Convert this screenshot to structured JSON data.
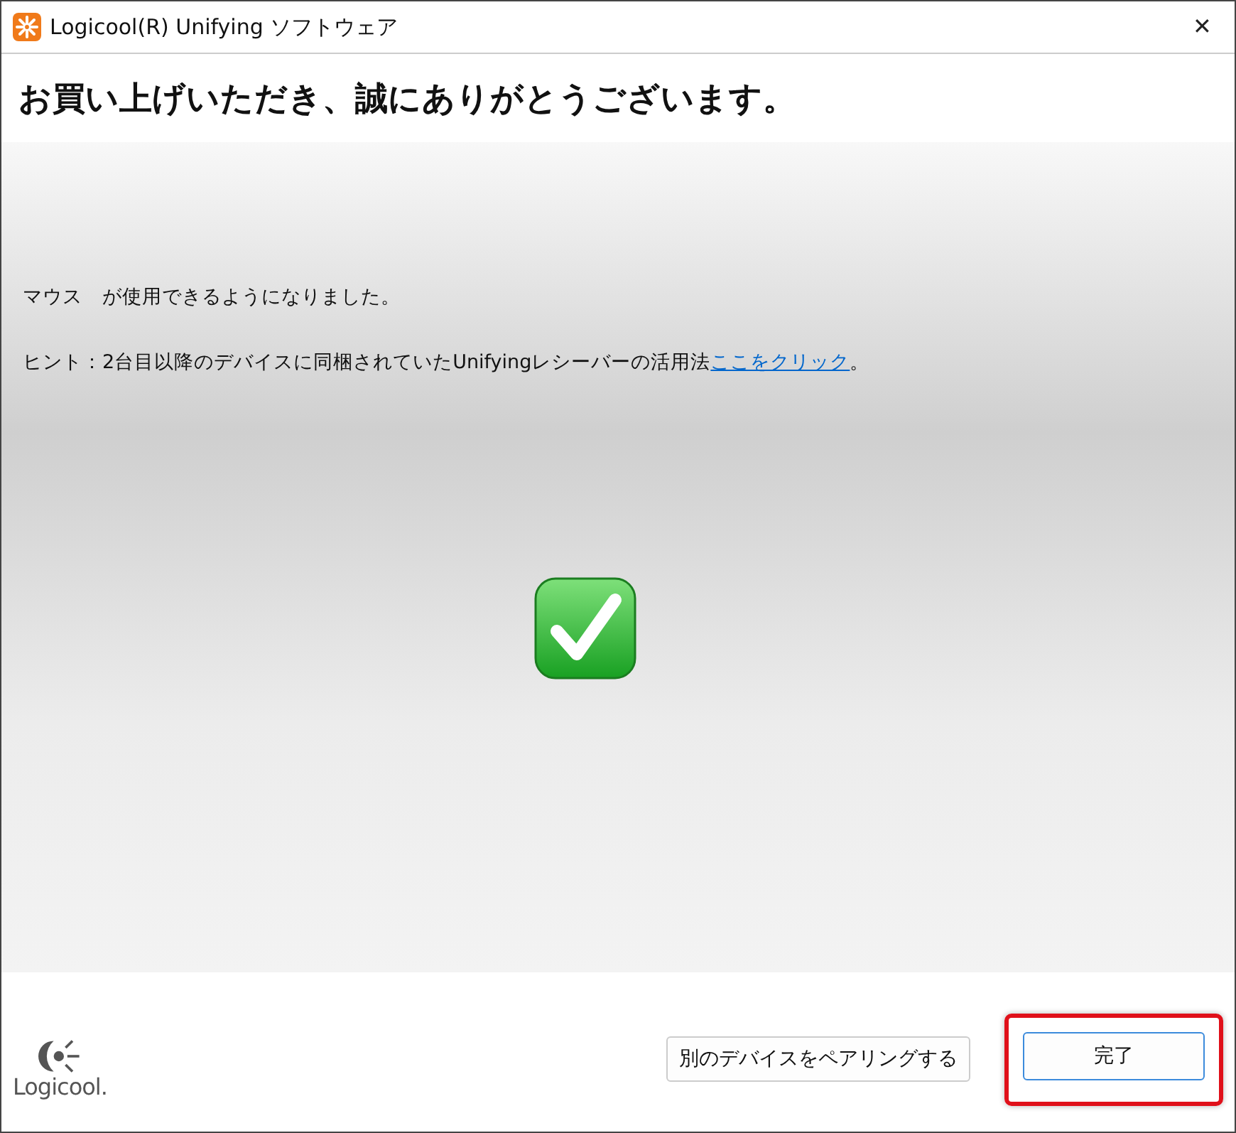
{
  "window": {
    "title": "Logicool(R) Unifying ソフトウェア",
    "close": "✕"
  },
  "heading": "お買い上げいただき、誠にありがとうございます。",
  "message": "マウス　が使用できるようになりました。",
  "hint": {
    "text": "ヒント：2台目以降のデバイスに同梱されていたUnifyingレシーバーの活用法",
    "link": "ここをクリック",
    "end": "。"
  },
  "logo": {
    "text": "Logicool."
  },
  "buttons": [
    {
      "label": "別のデバイスをペアリングする",
      "kind": "secondary",
      "highlighted": false
    },
    {
      "label": "完了",
      "kind": "primary",
      "highlighted": true
    }
  ]
}
